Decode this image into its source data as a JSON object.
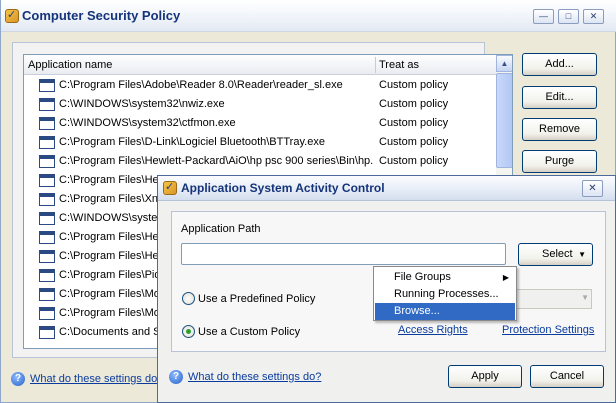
{
  "main_window": {
    "title": "Computer Security Policy",
    "controls": {
      "minimize": "—",
      "maximize": "□",
      "close": "✕"
    },
    "list": {
      "col_app": "Application name",
      "col_treat": "Treat as",
      "rows": [
        {
          "path": "C:\\Program Files\\Adobe\\Reader 8.0\\Reader\\reader_sl.exe",
          "treat": "Custom policy"
        },
        {
          "path": "C:\\WINDOWS\\system32\\nwiz.exe",
          "treat": "Custom policy"
        },
        {
          "path": "C:\\WINDOWS\\system32\\ctfmon.exe",
          "treat": "Custom policy"
        },
        {
          "path": "C:\\Program Files\\D-Link\\Logiciel Bluetooth\\BTTray.exe",
          "treat": "Custom policy"
        },
        {
          "path": "C:\\Program Files\\Hewlett-Packard\\AiO\\hp psc 900 series\\Bin\\hp...",
          "treat": "Custom policy"
        },
        {
          "path": "C:\\Program Files\\Hew",
          "treat": ""
        },
        {
          "path": "C:\\Program Files\\XnV",
          "treat": ""
        },
        {
          "path": "C:\\WINDOWS\\system",
          "treat": ""
        },
        {
          "path": "C:\\Program Files\\Hew",
          "treat": ""
        },
        {
          "path": "C:\\Program Files\\Hew",
          "treat": ""
        },
        {
          "path": "C:\\Program Files\\Pidg",
          "treat": ""
        },
        {
          "path": "C:\\Program Files\\Moz",
          "treat": ""
        },
        {
          "path": "C:\\Program Files\\Moz",
          "treat": ""
        },
        {
          "path": "C:\\Documents and S",
          "treat": ""
        }
      ]
    },
    "buttons": {
      "add": "Add...",
      "edit": "Edit...",
      "remove": "Remove",
      "purge": "Purge"
    },
    "help_link": "What do these settings do?"
  },
  "dialog": {
    "title": "Application System Activity Control",
    "close": "✕",
    "app_path_label": "Application Path",
    "app_path_value": "",
    "select_button": "Select",
    "menu": {
      "items": [
        "File Groups",
        "Running Processes...",
        "Browse..."
      ],
      "selected": "Browse..."
    },
    "radio_predefined": "Use a Predefined Policy",
    "radio_custom": "Use a Custom Policy",
    "selected_radio": "custom",
    "access_rights": "Access Rights",
    "protection_settings": "Protection Settings",
    "help_link": "What do these settings do?",
    "apply": "Apply",
    "cancel": "Cancel"
  }
}
